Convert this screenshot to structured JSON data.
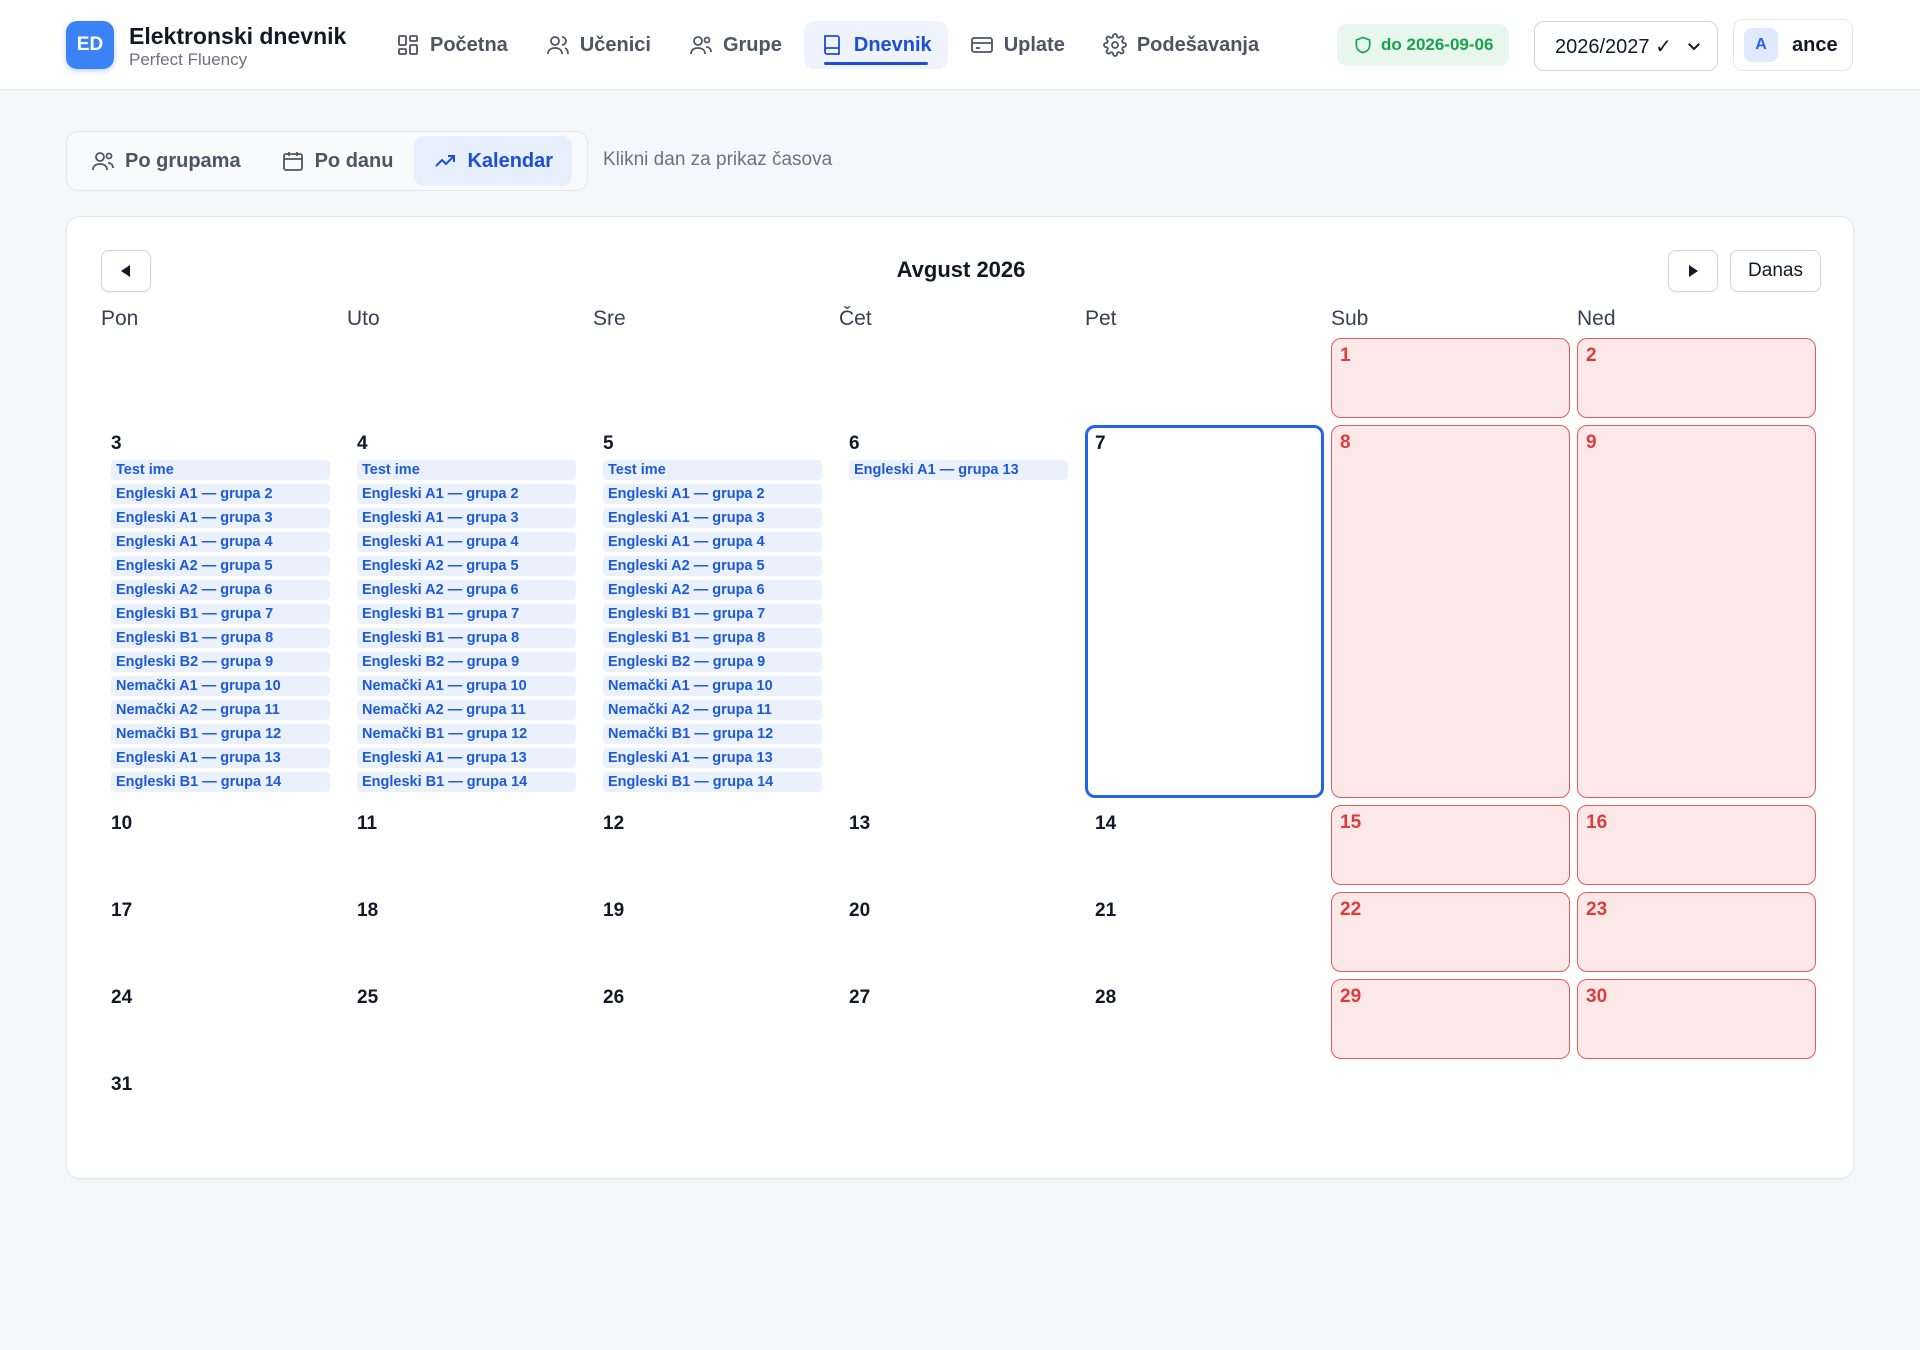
{
  "app": {
    "logo_text": "ED",
    "title": "Elektronski dnevnik",
    "subtitle": "Perfect Fluency"
  },
  "nav": [
    {
      "label": "Početna",
      "icon": "dashboard-icon",
      "active": false
    },
    {
      "label": "Učenici",
      "icon": "users-icon",
      "active": false
    },
    {
      "label": "Grupe",
      "icon": "group-icon",
      "active": false
    },
    {
      "label": "Dnevnik",
      "icon": "book-icon",
      "active": true
    },
    {
      "label": "Uplate",
      "icon": "credit-card-icon",
      "active": false
    },
    {
      "label": "Podešavanja",
      "icon": "gear-icon",
      "active": false
    }
  ],
  "license": {
    "label": "do 2026-09-06",
    "icon": "shield-icon",
    "color": "#16a34a"
  },
  "year_select": {
    "value": "2026/2027 ✓"
  },
  "user": {
    "initial": "A",
    "name": "ance"
  },
  "view_tabs": [
    {
      "label": "Po grupama",
      "icon": "users-icon",
      "active": false
    },
    {
      "label": "Po danu",
      "icon": "calendar-icon",
      "active": false
    },
    {
      "label": "Kalendar",
      "icon": "trend-icon",
      "active": true
    }
  ],
  "hint": "Klikni dan za prikaz časova",
  "calendar": {
    "month_title": "Avgust 2026",
    "today_button": "Danas",
    "weekdays": [
      "Pon",
      "Uto",
      "Sre",
      "Čet",
      "Pet",
      "Sub",
      "Ned"
    ],
    "today": 7,
    "days": [
      {
        "num": "1",
        "weekend": true,
        "events": []
      },
      {
        "num": "2",
        "weekend": true,
        "events": []
      },
      {
        "num": "3",
        "weekend": false,
        "events": [
          "Test ime",
          "Engleski A1 — grupa 2",
          "Engleski A1 — grupa 3",
          "Engleski A1 — grupa 4",
          "Engleski A2 — grupa 5",
          "Engleski A2 — grupa 6",
          "Engleski B1 — grupa 7",
          "Engleski B1 — grupa 8",
          "Engleski B2 — grupa 9",
          "Nemački A1 — grupa 10",
          "Nemački A2 — grupa 11",
          "Nemački B1 — grupa 12",
          "Engleski A1 — grupa 13",
          "Engleski B1 — grupa 14"
        ]
      },
      {
        "num": "4",
        "weekend": false,
        "events": [
          "Test ime",
          "Engleski A1 — grupa 2",
          "Engleski A1 — grupa 3",
          "Engleski A1 — grupa 4",
          "Engleski A2 — grupa 5",
          "Engleski A2 — grupa 6",
          "Engleski B1 — grupa 7",
          "Engleski B1 — grupa 8",
          "Engleski B2 — grupa 9",
          "Nemački A1 — grupa 10",
          "Nemački A2 — grupa 11",
          "Nemački B1 — grupa 12",
          "Engleski A1 — grupa 13",
          "Engleski B1 — grupa 14"
        ]
      },
      {
        "num": "5",
        "weekend": false,
        "events": [
          "Test ime",
          "Engleski A1 — grupa 2",
          "Engleski A1 — grupa 3",
          "Engleski A1 — grupa 4",
          "Engleski A2 — grupa 5",
          "Engleski A2 — grupa 6",
          "Engleski B1 — grupa 7",
          "Engleski B1 — grupa 8",
          "Engleski B2 — grupa 9",
          "Nemački A1 — grupa 10",
          "Nemački A2 — grupa 11",
          "Nemački B1 — grupa 12",
          "Engleski A1 — grupa 13",
          "Engleski B1 — grupa 14"
        ]
      },
      {
        "num": "6",
        "weekend": false,
        "events": [
          "Engleski A1 — grupa 13"
        ]
      },
      {
        "num": "7",
        "weekend": false,
        "events": []
      },
      {
        "num": "8",
        "weekend": true,
        "events": []
      },
      {
        "num": "9",
        "weekend": true,
        "events": []
      },
      {
        "num": "10",
        "weekend": false,
        "events": []
      },
      {
        "num": "11",
        "weekend": false,
        "events": []
      },
      {
        "num": "12",
        "weekend": false,
        "events": []
      },
      {
        "num": "13",
        "weekend": false,
        "events": []
      },
      {
        "num": "14",
        "weekend": false,
        "events": []
      },
      {
        "num": "15",
        "weekend": true,
        "events": []
      },
      {
        "num": "16",
        "weekend": true,
        "events": []
      },
      {
        "num": "17",
        "weekend": false,
        "events": []
      },
      {
        "num": "18",
        "weekend": false,
        "events": []
      },
      {
        "num": "19",
        "weekend": false,
        "events": []
      },
      {
        "num": "20",
        "weekend": false,
        "events": []
      },
      {
        "num": "21",
        "weekend": false,
        "events": []
      },
      {
        "num": "22",
        "weekend": true,
        "events": []
      },
      {
        "num": "23",
        "weekend": true,
        "events": []
      },
      {
        "num": "24",
        "weekend": false,
        "events": []
      },
      {
        "num": "25",
        "weekend": false,
        "events": []
      },
      {
        "num": "26",
        "weekend": false,
        "events": []
      },
      {
        "num": "27",
        "weekend": false,
        "events": []
      },
      {
        "num": "28",
        "weekend": false,
        "events": []
      },
      {
        "num": "29",
        "weekend": true,
        "events": []
      },
      {
        "num": "30",
        "weekend": true,
        "events": []
      },
      {
        "num": "31",
        "weekend": false,
        "events": []
      }
    ]
  },
  "colors": {
    "accent": "#1d4ed8",
    "weekend_bg": "#fde8e8",
    "weekend_border": "#e45b5b",
    "event_bg": "#eaf1fd",
    "event_text": "#1d5ad8"
  }
}
